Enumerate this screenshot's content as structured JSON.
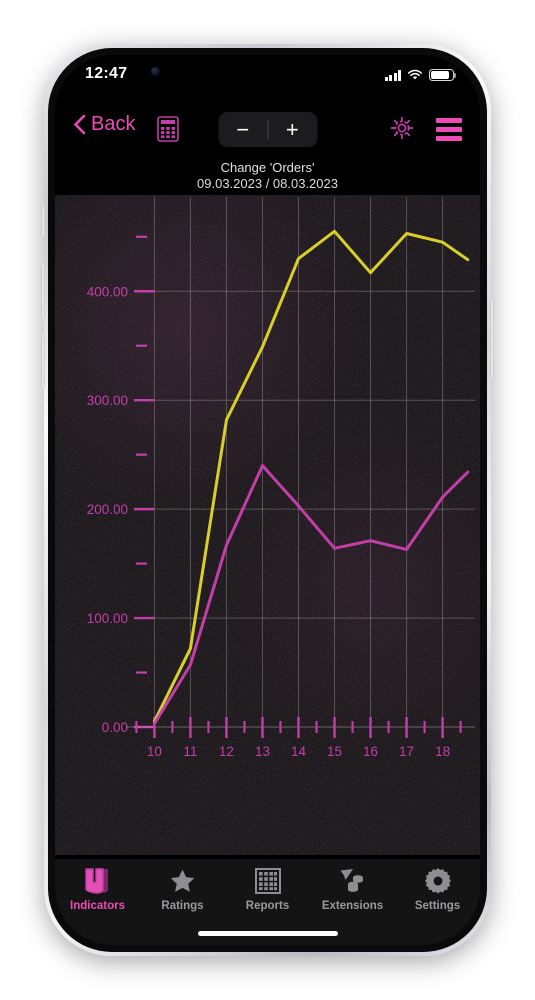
{
  "statusbar": {
    "time": "12:47",
    "cellular_icon": "signal-bars-icon",
    "wifi_icon": "wifi-icon",
    "battery_icon": "battery-icon"
  },
  "navbar": {
    "back_label": "Back",
    "back_icon": "chevron-left-icon",
    "calculator_icon": "calculator-icon",
    "zoom_out_label": "−",
    "zoom_in_label": "+",
    "settings_icon": "gear-icon",
    "list_icon": "list-icon",
    "accent": "#ec4bb8"
  },
  "chart_header": {
    "title": "Change 'Orders'",
    "subtitle": "09.03.2023 / 08.03.2023"
  },
  "chart_data": {
    "type": "line",
    "title": "Change 'Orders'",
    "subtitle": "09.03.2023 / 08.03.2023",
    "xlabel": "",
    "ylabel": "",
    "grid": true,
    "legend": "none",
    "x": [
      10,
      11,
      12,
      13,
      14,
      15,
      16,
      17,
      18,
      18.7
    ],
    "xticklabels": [
      "10",
      "11",
      "12",
      "13",
      "14",
      "15",
      "16",
      "17",
      "18"
    ],
    "yticklabels": [
      "0.00",
      "100.00",
      "200.00",
      "300.00",
      "400.00"
    ],
    "ytickvalues": [
      0,
      100,
      200,
      300,
      400
    ],
    "yminorticks": [
      50,
      150,
      250,
      350,
      450
    ],
    "ylim": [
      0,
      470
    ],
    "xlim": [
      9.6,
      18.9
    ],
    "series": [
      {
        "name": "09.03.2023",
        "color": "#d9cf2a",
        "values": [
          5,
          72,
          282,
          349,
          430,
          455,
          417,
          453,
          445,
          429
        ]
      },
      {
        "name": "08.03.2023",
        "color": "#c43ea8",
        "values": [
          3,
          57,
          167,
          240,
          203,
          164,
          171,
          163,
          211,
          234
        ]
      }
    ]
  },
  "tabbar": {
    "items": [
      {
        "label": "Indicators",
        "icon": "indicators-icon",
        "active": true
      },
      {
        "label": "Ratings",
        "icon": "star-icon",
        "active": false
      },
      {
        "label": "Reports",
        "icon": "grid-icon",
        "active": false
      },
      {
        "label": "Extensions",
        "icon": "coins-icon",
        "active": false
      },
      {
        "label": "Settings",
        "icon": "gear-icon",
        "active": false
      }
    ]
  }
}
